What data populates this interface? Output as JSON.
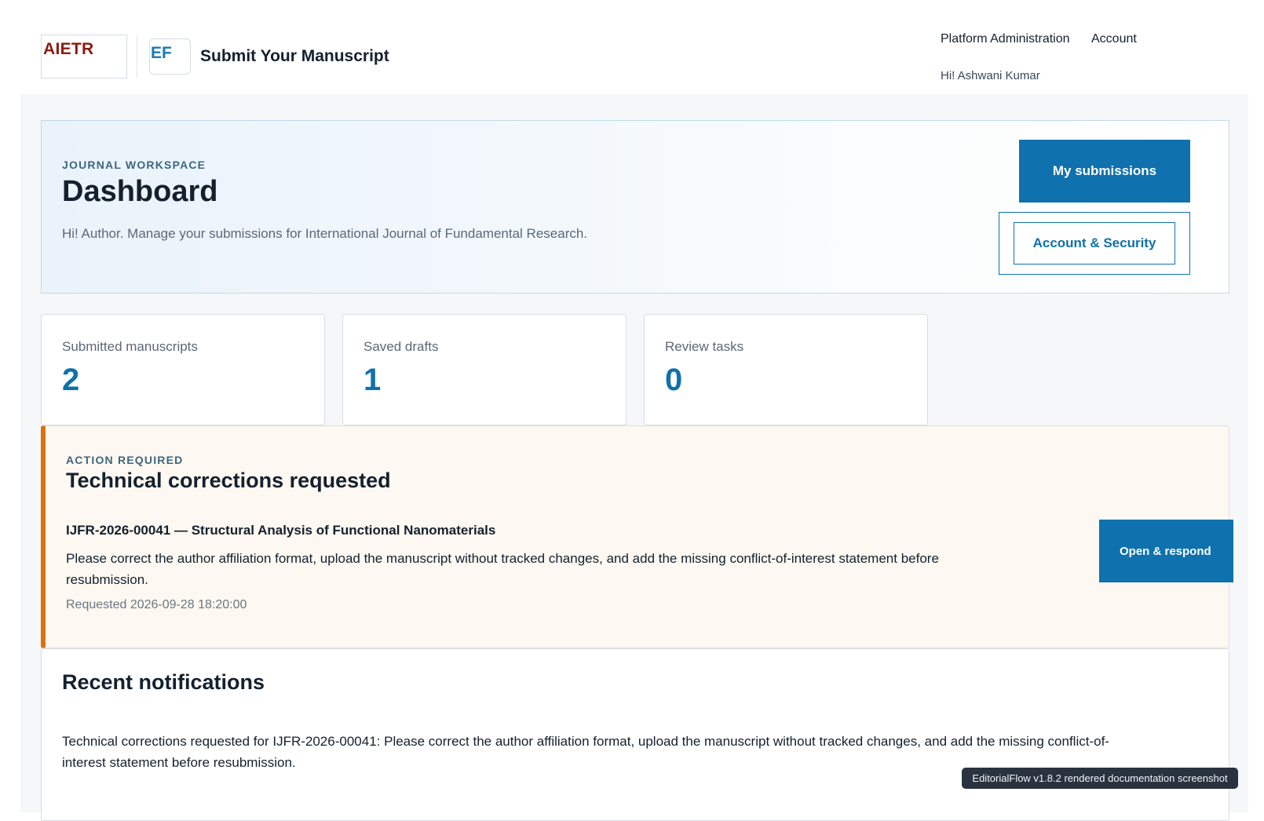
{
  "header": {
    "logo_primary": "AIETR",
    "logo_secondary": "EF",
    "site_title": "Submit Your Manuscript",
    "nav": [
      {
        "label": "Platform Administration"
      },
      {
        "label": "Account"
      }
    ],
    "greeting": "Hi! Ashwani Kumar"
  },
  "hero": {
    "eyebrow": "JOURNAL WORKSPACE",
    "title": "Dashboard",
    "subtitle": "Hi! Author. Manage your submissions for International Journal of Fundamental Research.",
    "primary_button": "My submissions",
    "secondary_button": "Account & Security"
  },
  "stats": [
    {
      "label": "Submitted manuscripts",
      "value": "2"
    },
    {
      "label": "Saved drafts",
      "value": "1"
    },
    {
      "label": "Review tasks",
      "value": "0"
    }
  ],
  "action": {
    "eyebrow": "ACTION REQUIRED",
    "title": "Technical corrections requested",
    "manuscript_title": "IJFR-2026-00041 — Structural Analysis of Functional Nanomaterials",
    "message": "Please correct the author affiliation format, upload the manuscript without tracked changes, and add the missing conflict-of-interest statement before resubmission.",
    "requested": "Requested 2026-09-28 18:20:00",
    "button": "Open & respond"
  },
  "notifications": {
    "title": "Recent notifications",
    "items": [
      "Technical corrections requested for IJFR-2026-00041: Please correct the author affiliation format, upload the manuscript without tracked changes, and add the missing conflict-of-interest statement before resubmission."
    ]
  },
  "tooltip": "EditorialFlow v1.8.2 rendered documentation screenshot",
  "colors": {
    "accent": "#0f71ad",
    "warning": "#d9730d",
    "logo_red": "#8b1a0e"
  }
}
